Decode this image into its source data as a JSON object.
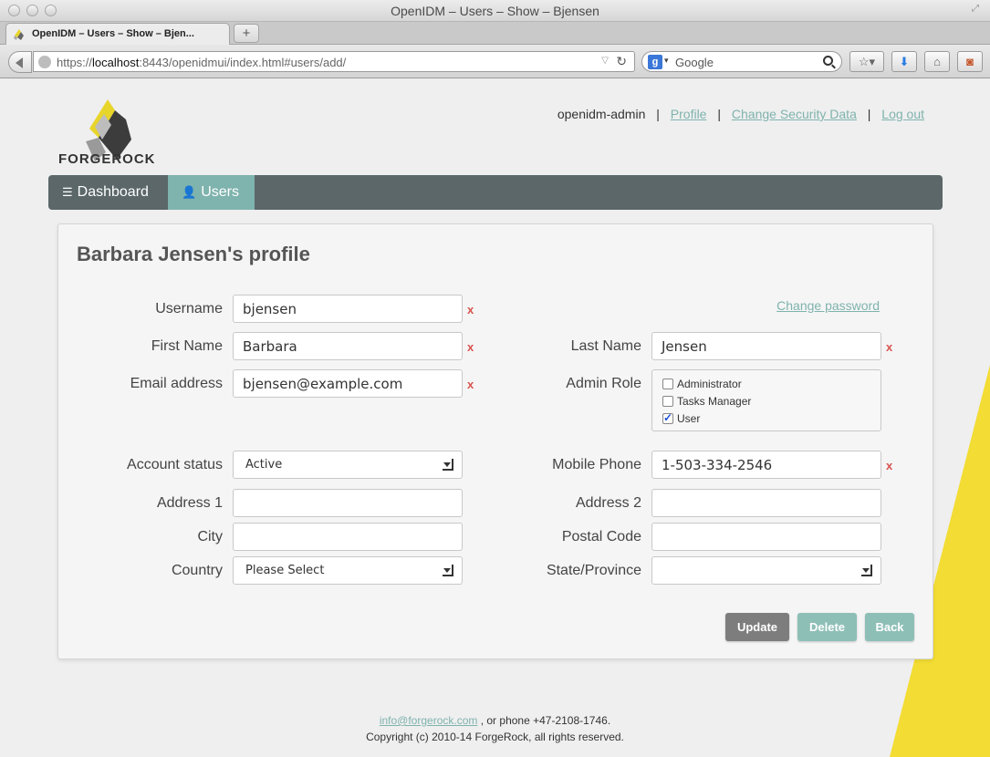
{
  "window": {
    "title": "OpenIDM – Users – Show – Bjensen"
  },
  "tab": {
    "title": "OpenIDM – Users – Show – Bjen...",
    "new_tab": "+"
  },
  "browser": {
    "url_prefix": "https://",
    "url_host": "localhost",
    "url_rest": ":8443/openidmui/index.html#users/add/",
    "search_engine_letter": "g",
    "search_placeholder": "Google"
  },
  "header": {
    "brand": "FORGEROCK",
    "username": "openidm-admin",
    "links": {
      "profile": "Profile",
      "security": "Change Security Data",
      "logout": "Log out"
    },
    "separator": "|"
  },
  "nav": {
    "dashboard": "Dashboard",
    "users": "Users"
  },
  "profile": {
    "title": "Barbara Jensen's profile",
    "change_password": "Change password",
    "x_mark": "x",
    "labels": {
      "username": "Username",
      "first_name": "First Name",
      "email": "Email address",
      "account_status": "Account status",
      "address1": "Address 1",
      "city": "City",
      "country": "Country",
      "last_name": "Last Name",
      "admin_role": "Admin Role",
      "mobile": "Mobile Phone",
      "address2": "Address 2",
      "postal": "Postal Code",
      "state": "State/Province"
    },
    "values": {
      "username": "bjensen",
      "first_name": "Barbara",
      "email": "bjensen@example.com",
      "account_status": "Active",
      "address1": "",
      "city": "",
      "country": "Please Select",
      "last_name": "Jensen",
      "mobile": "1-503-334-2546",
      "address2": "",
      "postal": "",
      "state": ""
    },
    "roles": [
      {
        "label": "Administrator",
        "checked": false
      },
      {
        "label": "Tasks Manager",
        "checked": false
      },
      {
        "label": "User",
        "checked": true
      }
    ],
    "buttons": {
      "update": "Update",
      "delete": "Delete",
      "back": "Back"
    }
  },
  "footer": {
    "email": "info@forgerock.com",
    "phone_text": ", or phone +47-2108-1746.",
    "copyright": "Copyright (c) 2010-14 ForgeRock, all rights reserved."
  },
  "colors": {
    "accent": "#7fb3ad",
    "nav_bg": "#5b6769",
    "update_btn": "#7d7d7d",
    "error": "#d9534f",
    "brand_yellow": "#f3dc33"
  }
}
